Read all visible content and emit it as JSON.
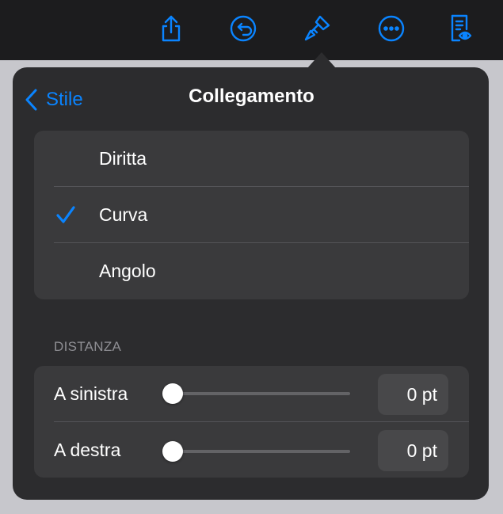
{
  "toolbar": {
    "buttons": [
      {
        "icon": "share-icon"
      },
      {
        "icon": "undo-icon"
      },
      {
        "icon": "format-brush-icon"
      },
      {
        "icon": "more-icon"
      },
      {
        "icon": "document-view-icon"
      }
    ],
    "accent": "#0a84ff"
  },
  "popover": {
    "back_label": "Stile",
    "title": "Collegamento",
    "options": [
      {
        "label": "Diritta",
        "selected": false
      },
      {
        "label": "Curva",
        "selected": true
      },
      {
        "label": "Angolo",
        "selected": false
      }
    ],
    "distance": {
      "header": "DISTANZA",
      "rows": [
        {
          "label": "A sinistra",
          "value": "0 pt",
          "slider_level": 0
        },
        {
          "label": "A destra",
          "value": "0 pt",
          "slider_level": 0
        }
      ]
    }
  },
  "colors": {
    "background": "#1c1c1e",
    "popover": "#2c2c2e",
    "group": "#3a3a3c",
    "accent": "#0a84ff",
    "secondary_text": "#8e8e93"
  }
}
